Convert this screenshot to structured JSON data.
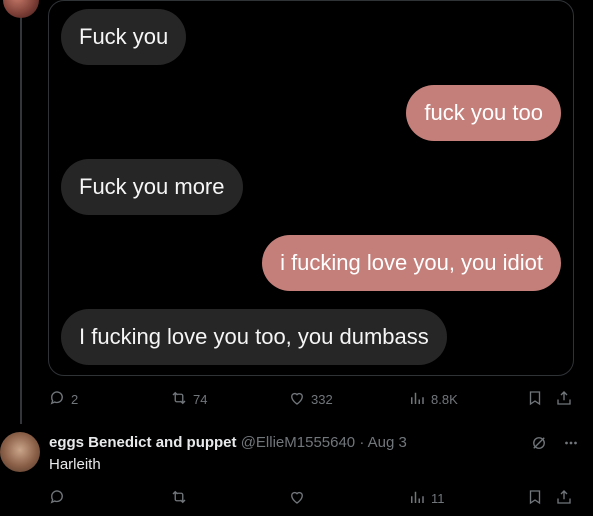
{
  "media": {
    "messages": [
      {
        "text": "Fuck you",
        "side": "left"
      },
      {
        "text": "fuck you too",
        "side": "right"
      },
      {
        "text": "Fuck you more",
        "side": "left"
      },
      {
        "text": "i fucking love you, you idiot",
        "side": "right"
      },
      {
        "text": "I fucking love you too, you dumbass",
        "side": "left"
      }
    ]
  },
  "post_actions": {
    "replies": "2",
    "reposts": "74",
    "likes": "332",
    "views": "8.8K"
  },
  "reply": {
    "author_name": "eggs Benedict and puppet",
    "author_handle": "@EllieM1555640",
    "separator": "·",
    "date": "Aug 3",
    "text": "Harleith",
    "views": "11"
  },
  "icons": [
    "reply-icon",
    "repost-icon",
    "like-icon",
    "views-icon",
    "bookmark-icon",
    "share-icon",
    "grok-icon",
    "more-icon"
  ]
}
